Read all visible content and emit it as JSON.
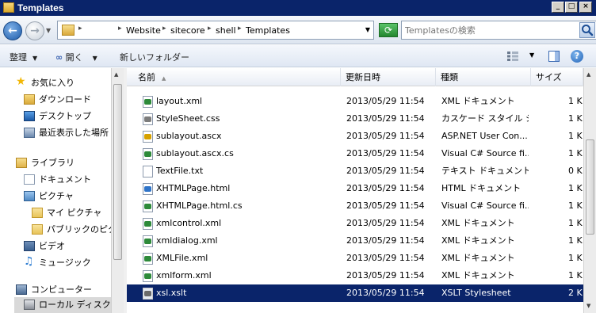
{
  "window": {
    "title": "Templates",
    "caption_buttons": {
      "minimize": "_",
      "maximize": "□",
      "close": "×"
    }
  },
  "address": {
    "crumbs": [
      "Website",
      "sitecore",
      "shell",
      "Templates"
    ],
    "separator": "▸",
    "leading_separator": "▸"
  },
  "search": {
    "placeholder": "Templatesの検索"
  },
  "toolbar": {
    "organize_label": "整理",
    "open_label": "開く",
    "new_folder_label": "新しいフォルダー",
    "help_label": "?"
  },
  "nav": {
    "items": [
      {
        "label": "お気に入り",
        "icon": "star-icon",
        "color": "#f2b705"
      },
      {
        "label": "ダウンロード",
        "icon": "download-folder-icon",
        "color": "#3c84c9"
      },
      {
        "label": "デスクトップ",
        "icon": "desktop-icon",
        "color": "#2f6db3"
      },
      {
        "label": "最近表示した場所",
        "icon": "recent-places-icon",
        "color": "#6a88ad"
      },
      {
        "label": "ライブラリ",
        "icon": "library-icon",
        "color": "#e0b34a"
      },
      {
        "label": "ドキュメント",
        "icon": "documents-icon",
        "color": "#8a9ab0"
      },
      {
        "label": "ピクチャ",
        "icon": "pictures-icon",
        "color": "#4f8ac4"
      },
      {
        "label": "マイ ピクチャ",
        "icon": "folder-icon",
        "color": "#e8c45a"
      },
      {
        "label": "パブリックのピクチャ",
        "icon": "folder-icon",
        "color": "#e8c45a"
      },
      {
        "label": "ビデオ",
        "icon": "videos-icon",
        "color": "#3a5f8f"
      },
      {
        "label": "ミュージック",
        "icon": "music-icon",
        "color": "#2a7bd1"
      },
      {
        "label": "コンピューター",
        "icon": "computer-icon",
        "color": "#4a6a92"
      },
      {
        "label": "ローカル ディスク (C",
        "icon": "local-disk-icon",
        "color": "#8a8f98"
      }
    ]
  },
  "columns": {
    "name": "名前",
    "modified": "更新日時",
    "type": "種類",
    "size": "サイズ",
    "sort_indicator": "▲"
  },
  "files": [
    {
      "name": "layout.xml",
      "modified": "2013/05/29 11:54",
      "type": "XML ドキュメント",
      "size": "1 K",
      "icon": "xml-file-icon",
      "color": "#2d8a3a"
    },
    {
      "name": "StyleSheet.css",
      "modified": "2013/05/29 11:54",
      "type": "カスケード スタイル シ...",
      "size": "1 K",
      "icon": "css-file-icon",
      "color": "#7c7c7c"
    },
    {
      "name": "sublayout.ascx",
      "modified": "2013/05/29 11:54",
      "type": "ASP.NET User Con...",
      "size": "1 K",
      "icon": "ascx-file-icon",
      "color": "#d6a100"
    },
    {
      "name": "sublayout.ascx.cs",
      "modified": "2013/05/29 11:54",
      "type": "Visual C# Source fi...",
      "size": "1 K",
      "icon": "csharp-file-icon",
      "color": "#2d8a3a"
    },
    {
      "name": "TextFile.txt",
      "modified": "2013/05/29 11:54",
      "type": "テキスト ドキュメント",
      "size": "0 K",
      "icon": "text-file-icon",
      "color": "#ffffff"
    },
    {
      "name": "XHTMLPage.html",
      "modified": "2013/05/29 11:54",
      "type": "HTML ドキュメント",
      "size": "1 K",
      "icon": "html-file-icon",
      "color": "#2f74c9"
    },
    {
      "name": "XHTMLPage.html.cs",
      "modified": "2013/05/29 11:54",
      "type": "Visual C# Source fi...",
      "size": "1 K",
      "icon": "csharp-file-icon",
      "color": "#2d8a3a"
    },
    {
      "name": "xmlcontrol.xml",
      "modified": "2013/05/29 11:54",
      "type": "XML ドキュメント",
      "size": "1 K",
      "icon": "xml-file-icon",
      "color": "#2d8a3a"
    },
    {
      "name": "xmldialog.xml",
      "modified": "2013/05/29 11:54",
      "type": "XML ドキュメント",
      "size": "1 K",
      "icon": "xml-file-icon",
      "color": "#2d8a3a"
    },
    {
      "name": "XMLFile.xml",
      "modified": "2013/05/29 11:54",
      "type": "XML ドキュメント",
      "size": "1 K",
      "icon": "xml-file-icon",
      "color": "#2d8a3a"
    },
    {
      "name": "xmlform.xml",
      "modified": "2013/05/29 11:54",
      "type": "XML ドキュメント",
      "size": "1 K",
      "icon": "xml-file-icon",
      "color": "#2d8a3a"
    },
    {
      "name": "xsl.xslt",
      "modified": "2013/05/29 11:54",
      "type": "XSLT Stylesheet",
      "size": "2 K",
      "icon": "xslt-file-icon",
      "color": "#6a6a6a",
      "selected": true
    }
  ]
}
